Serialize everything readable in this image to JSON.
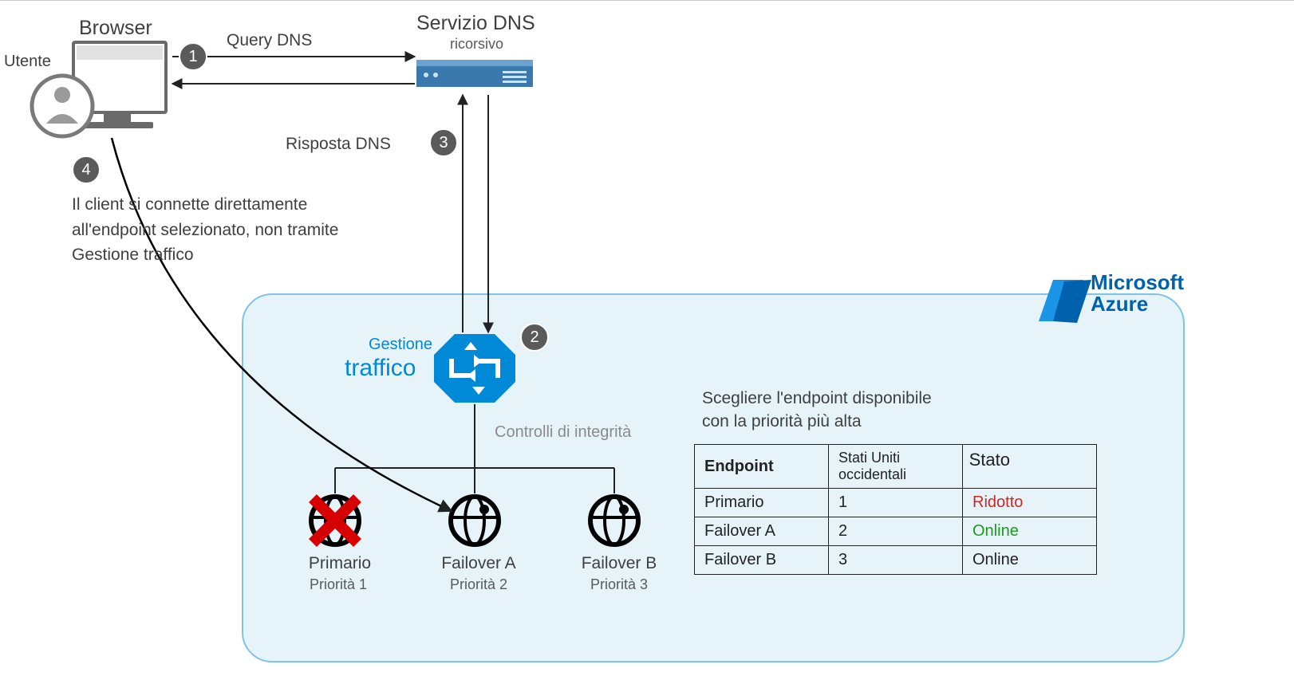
{
  "labels": {
    "user": "Utente",
    "browser": "Browser",
    "query_dns": "Query DNS",
    "dns_service_title": "Servizio DNS",
    "dns_service_sub": "ricorsivo",
    "risposta_dns": "Risposta DNS",
    "client_connects_l1": "Il client si connette direttamente",
    "client_connects_l2": "all'endpoint selezionato, non tramite",
    "client_connects_l3": "Gestione traffico",
    "tm_gestione": "Gestione",
    "tm_traffico": "traffico",
    "health_checks": "Controlli di integrità",
    "endpoint_choose_l1": "Scegliere l'endpoint disponibile",
    "endpoint_choose_l2": "con la priorità più alta",
    "azure_l1": "Microsoft",
    "azure_l2": "Azure",
    "ep1_name": "Primario",
    "ep1_prio_label": "Priorità 1",
    "ep2_name": "Failover A",
    "ep2_prio_label": "Priorità 2",
    "ep3_name": "Failover B",
    "ep3_prio_label": "Priorità 3"
  },
  "steps": {
    "s1": "1",
    "s2": "2",
    "s3": "3",
    "s4": "4"
  },
  "table": {
    "h_endpoint": "Endpoint",
    "h_region": "Stati Uniti occidentali",
    "h_status": "Stato",
    "rows": [
      {
        "endpoint": "Primario",
        "priority": "1",
        "status": "Ridotto",
        "status_class": "status-degraded"
      },
      {
        "endpoint": "Failover A",
        "priority": "2",
        "status": "Online",
        "status_class": "status-online"
      },
      {
        "endpoint": "Failover B",
        "priority": "3",
        "status": "Online",
        "status_class": ""
      }
    ]
  },
  "chart_data": {
    "type": "diagram",
    "title": "Azure Traffic Manager priority routing with health checks",
    "nodes": [
      {
        "id": "user",
        "label": "Utente"
      },
      {
        "id": "browser",
        "label": "Browser"
      },
      {
        "id": "dns_service",
        "label": "Servizio DNS ricorsivo"
      },
      {
        "id": "traffic_mgr",
        "label": "Gestione traffico"
      },
      {
        "id": "ep_primary",
        "label": "Primario",
        "priority": 1,
        "status": "Ridotto"
      },
      {
        "id": "ep_failoverA",
        "label": "Failover A",
        "priority": 2,
        "status": "Online"
      },
      {
        "id": "ep_failoverB",
        "label": "Failover B",
        "priority": 3,
        "status": "Online"
      }
    ],
    "edges": [
      {
        "from": "browser",
        "to": "dns_service",
        "label": "Query DNS",
        "step": 1
      },
      {
        "from": "dns_service",
        "to": "traffic_mgr",
        "label": "",
        "step": 2,
        "bidirectional": true
      },
      {
        "from": "traffic_mgr",
        "to": "dns_service",
        "label": "Risposta DNS",
        "step": 3
      },
      {
        "from": "dns_service",
        "to": "browser",
        "label": "",
        "step": 3
      },
      {
        "from": "browser",
        "to": "ep_failoverA",
        "label": "Il client si connette direttamente all'endpoint selezionato, non tramite Gestione traffico",
        "step": 4
      },
      {
        "from": "traffic_mgr",
        "to": "ep_primary",
        "label": "Controlli di integrità"
      },
      {
        "from": "traffic_mgr",
        "to": "ep_failoverA",
        "label": "Controlli di integrità"
      },
      {
        "from": "traffic_mgr",
        "to": "ep_failoverB",
        "label": "Controlli di integrità"
      }
    ],
    "endpoint_table": {
      "columns": [
        "Endpoint",
        "Stati Uniti occidentali",
        "Stato"
      ],
      "rows": [
        [
          "Primario",
          1,
          "Ridotto"
        ],
        [
          "Failover A",
          2,
          "Online"
        ],
        [
          "Failover B",
          3,
          "Online"
        ]
      ]
    }
  }
}
